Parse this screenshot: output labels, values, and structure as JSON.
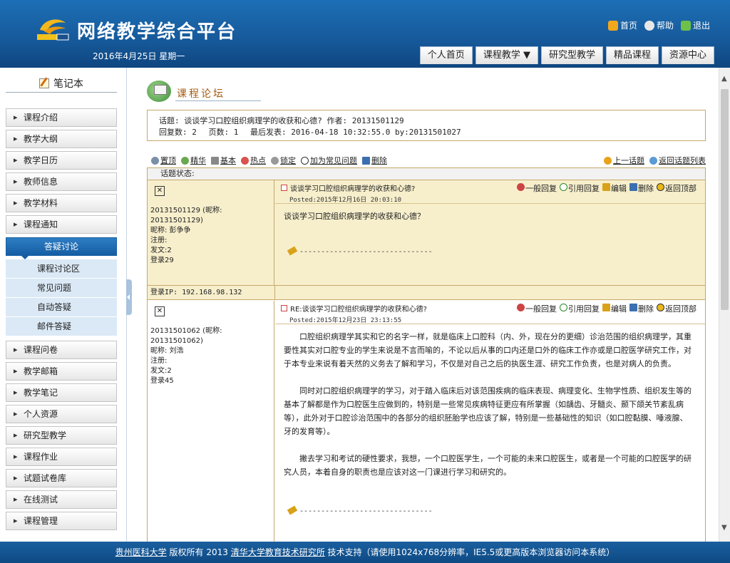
{
  "header": {
    "site_title": "网络教学综合平台",
    "date": "2016年4月25日 星期一",
    "top_links": [
      {
        "label": "首页",
        "color": "#f2a81c"
      },
      {
        "label": "帮助",
        "color": "#e8e8e8"
      },
      {
        "label": "退出",
        "color": "#6fc04a"
      }
    ],
    "nav_tabs": [
      "个人首页",
      "课程教学 ▼",
      "研究型教学",
      "精品课程",
      "资源中心"
    ]
  },
  "sidebar": {
    "notebook": "笔记本",
    "items_top": [
      "课程介绍",
      "教学大纲",
      "教学日历",
      "教师信息",
      "教学材料",
      "课程通知"
    ],
    "active": "答疑讨论",
    "sub_items": [
      "课程讨论区",
      "常见问题",
      "自动答疑",
      "邮件答疑"
    ],
    "items_bottom": [
      "课程问卷",
      "教学邮箱",
      "教学笔记",
      "个人资源",
      "研究型教学",
      "课程作业",
      "试题试卷库",
      "在线测试",
      "课程管理"
    ]
  },
  "forum": {
    "title": "课程论坛",
    "topic_line": "话题: 谈谈学习口腔组织病理学的收获和心德? 作者: 20131501129",
    "reply_count": "回复数: 2",
    "page_count": "页数: 1",
    "last_post": "最后发表: 2016-04-18 10:32:55.0 by:20131501027",
    "toolbar": [
      "置顶",
      "精华",
      "基本",
      "热点",
      "锁定",
      "加为常见问题",
      "删除"
    ],
    "toolbar_right": [
      "上一话题",
      "返回话题列表"
    ],
    "status_label": "话题状态:"
  },
  "actions": [
    "一般回复",
    "引用回复",
    "编辑",
    "删除",
    "返回顶部"
  ],
  "posts": [
    {
      "author_id": "20131501129 (昵称:",
      "author_id2": "20131501129)",
      "nickname": "昵称: 彭争争",
      "register": "注册:",
      "posts": "发文:2",
      "logins": "登录29",
      "subject": "谈谈学习口腔组织病理学的收获和心德?",
      "posted": "Posted:2015年12月16日 20:03:10",
      "body": [
        "谈谈学习口腔组织病理学的收获和心德？"
      ],
      "signature": "-------------------------------",
      "ip": "登录IP: 192.168.98.132"
    },
    {
      "author_id": "20131501062 (昵称:",
      "author_id2": "20131501062)",
      "nickname": "昵称: 刘浩",
      "register": "注册:",
      "posts": "发文:2",
      "logins": "登录45",
      "subject": "RE:谈谈学习口腔组织病理学的收获和心德?",
      "posted": "Posted:2015年12月23日 23:13:55",
      "body": [
        "口腔组织病理学其实和它的名字一样，就是临床上口腔科（内、外，现在分的更细）诊治范围的组织病理学，其重要性其实对口腔专业的学生来说是不言而喻的，不论以后从事的口内还是口外的临床工作亦或是口腔医学研究工作，对于本专业来说有着天然的义务去了解和学习，不仅是对自己之后的执医生涯、研究工作负责，也是对病人的负责。",
        "同时对口腔组织病理学的学习，对于踏入临床后对该范围疾病的临床表现、病理变化、生物学性质、组织发生等的基本了解都是作为口腔医生应做到的，特别是一些常见疾病特征更应有所掌握（如龋齿、牙髓炎、颞下颌关节紊乱病等），此外对于口腔诊治范围中的各部分的组织胚胎学也应该了解，特别是一些基础性的知识（如口腔黏膜、唾液腺、牙的发育等）。",
        "撇去学习和考试的硬性要求，我想，一个口腔医学生，一个可能的未来口腔医生，或者是一个可能的口腔医学的研究人员，本着自身的职责也是应该对这一门课进行学习和研究的。"
      ],
      "signature": "-------------------------------"
    }
  ],
  "footer": {
    "school": "贵州医科大学",
    "copyright": "版权所有 2013",
    "institute": "清华大学教育技术研究所",
    "support": "技术支持（请使用1024x768分辨率，IE5.5或更高版本浏览器访问本系统）"
  }
}
